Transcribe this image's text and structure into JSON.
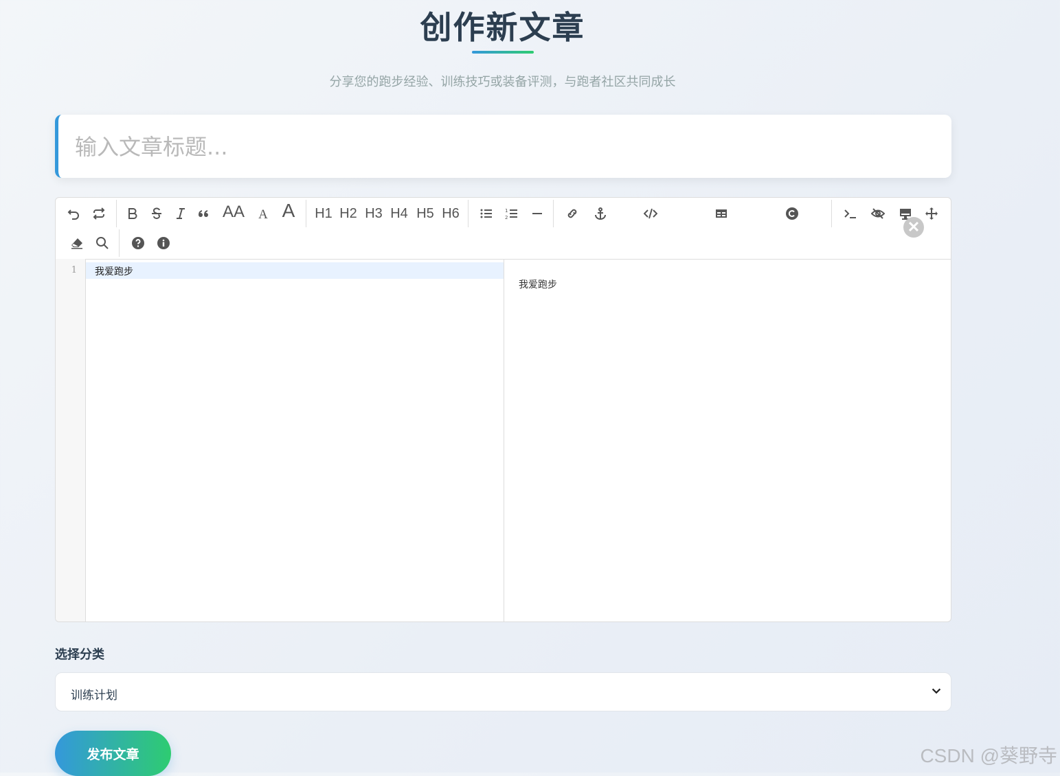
{
  "header": {
    "title": "创作新文章",
    "subtitle": "分享您的跑步经验、训练技巧或装备评测，与跑者社区共同成长"
  },
  "title_input": {
    "placeholder": "输入文章标题...",
    "value": ""
  },
  "toolbar": {
    "text_buttons": {
      "big_font": "AA",
      "font_small": "A",
      "font_large": "A",
      "h1": "H1",
      "h2": "H2",
      "h3": "H3",
      "h4": "H4",
      "h5": "H5",
      "h6": "H6"
    },
    "icons": [
      "undo-icon",
      "redo-icon",
      "bold-icon",
      "strikethrough-icon",
      "italic-icon",
      "quote-icon",
      "unordered-list-icon",
      "ordered-list-icon",
      "horizontal-rule-icon",
      "link-icon",
      "anchor-icon",
      "code-block-icon",
      "table-icon",
      "copyright-icon",
      "terminal-icon",
      "hide-preview-icon",
      "monitor-icon",
      "move-icon",
      "eraser-icon",
      "search-icon",
      "help-icon",
      "info-icon",
      "close-icon"
    ]
  },
  "editor": {
    "line_number": "1",
    "content": "我爱跑步",
    "preview": "我爱跑步"
  },
  "category": {
    "label": "选择分类",
    "selected": "训练计划"
  },
  "publish_button": "发布文章",
  "watermark": "CSDN @葵野寺"
}
